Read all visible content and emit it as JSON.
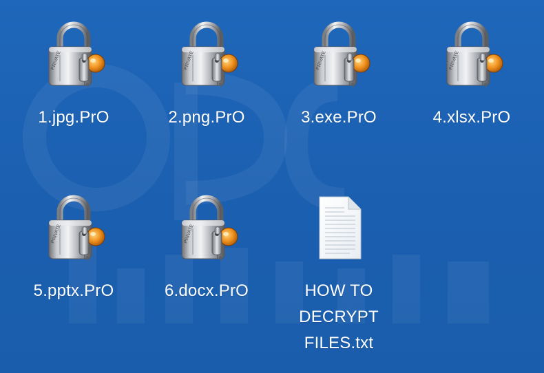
{
  "desktop": {
    "files": [
      {
        "name": "1.jpg.PrO",
        "icon": "padlock-icon"
      },
      {
        "name": "2.png.PrO",
        "icon": "padlock-icon"
      },
      {
        "name": "3.exe.PrO",
        "icon": "padlock-icon"
      },
      {
        "name": "4.xlsx.PrO",
        "icon": "padlock-icon"
      },
      {
        "name": "5.pptx.PrO",
        "icon": "padlock-icon"
      },
      {
        "name": "6.docx.PrO",
        "icon": "padlock-icon"
      },
      {
        "name": "HOW TO\nDECRYPT\nFILES.txt",
        "icon": "text-document-icon"
      }
    ],
    "padlock_tag": "PRIVATE",
    "colors": {
      "background": "#1c63b5",
      "label": "#ffffff",
      "key_accent": "#e8891e"
    }
  }
}
